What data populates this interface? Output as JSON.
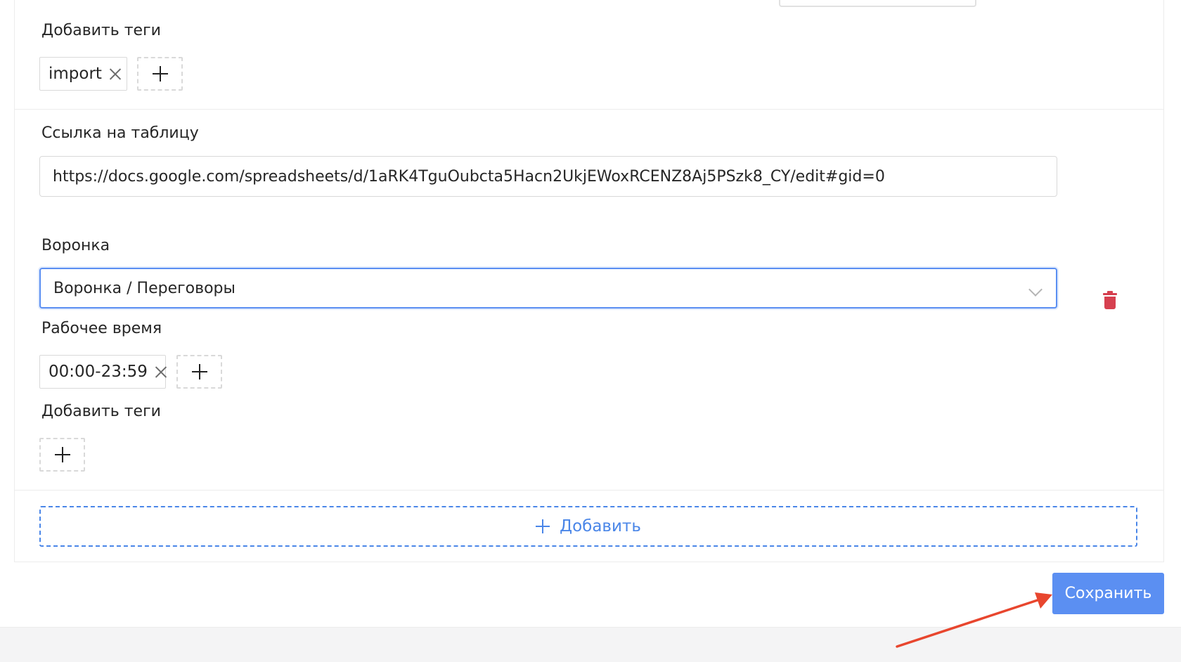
{
  "section_one": {
    "tags_label": "Добавить теги",
    "tags": [
      "import"
    ]
  },
  "section_two": {
    "table_link_label": "Ссылка на таблицу",
    "table_link_value": "https://docs.google.com/spreadsheets/d/1aRK4TguOubcta5Hacn2UkjEWoxRCENZ8Aj5PSzk8_CY/edit#gid=0",
    "funnel_label": "Воронка",
    "funnel_value": "Воронка / Переговоры",
    "work_time_label": "Рабочее время",
    "work_time_tags": [
      "00:00-23:59"
    ],
    "tags_label": "Добавить теги"
  },
  "add_button_label": "Добавить",
  "save_button_label": "Сохранить",
  "colors": {
    "accent": "#5b8ff2",
    "link_blue": "#4a86e8",
    "delete_red": "#d6404f",
    "annotation_arrow": "#e8462e"
  },
  "icons": {
    "remove_tag": "close-icon",
    "add_tag": "plus-icon",
    "dropdown": "chevron-down-icon",
    "delete": "trash-icon"
  }
}
